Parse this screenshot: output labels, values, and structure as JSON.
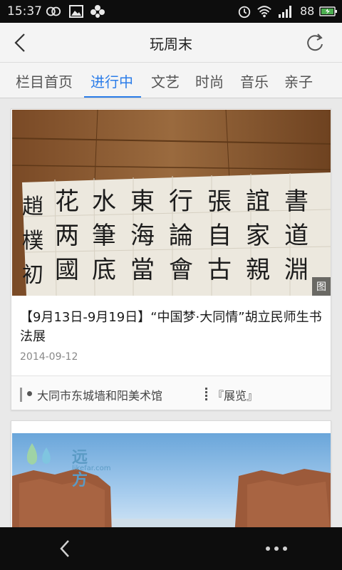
{
  "status_bar": {
    "time": "15:37",
    "battery_percent": "88",
    "left_icons": [
      "infinity-icon",
      "image-icon",
      "clover-icon"
    ],
    "right_icons": [
      "alarm-icon",
      "wifi-icon",
      "signal-icon",
      "battery-icon"
    ],
    "battery_color": "#4caf50"
  },
  "header": {
    "title": "玩周末",
    "back_icon": "chevron-left-icon",
    "refresh_icon": "refresh-icon"
  },
  "tabs": [
    {
      "label": "栏目首页",
      "active": false
    },
    {
      "label": "进行中",
      "active": true
    },
    {
      "label": "文艺",
      "active": false
    },
    {
      "label": "时尚",
      "active": false
    },
    {
      "label": "音乐",
      "active": false
    },
    {
      "label": "亲子",
      "active": false
    }
  ],
  "accent_color": "#2b7de9",
  "events": [
    {
      "title": "【9月13日-9月19日】“中国梦·大同情”胡立民师生书法展",
      "date": "2014-09-12",
      "image_badge": "图",
      "venue": "大同市东城墙和阳美术馆",
      "category": "『展览』"
    },
    {
      "watermark": "远方",
      "watermark_sub": "likefar.com"
    }
  ],
  "bottom_nav": {
    "back_icon": "back-arrow-icon",
    "more_icon": "more-dots-icon"
  }
}
